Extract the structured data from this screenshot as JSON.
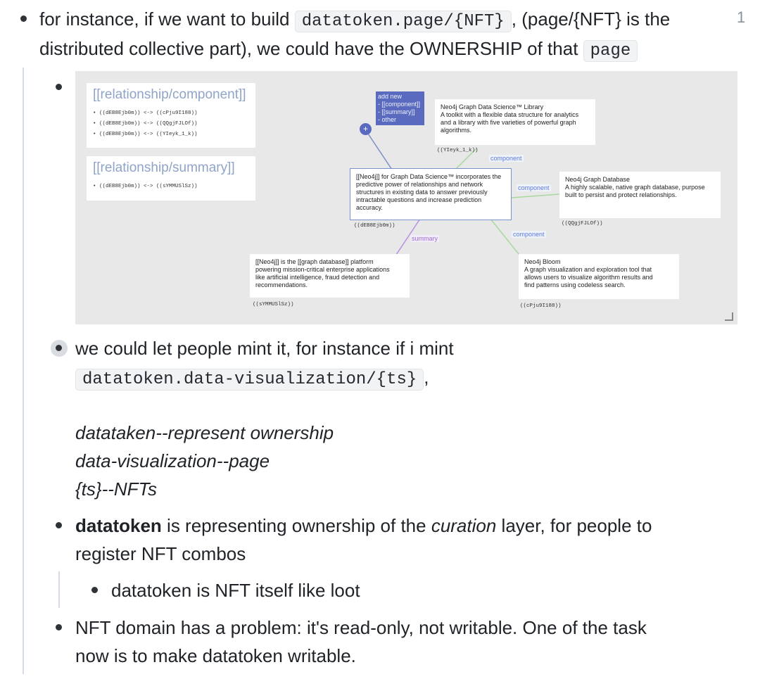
{
  "counter": "1",
  "top_block": {
    "line1_a": "for instance, if we want to build ",
    "line1_code": "datatoken.page/{NFT}",
    "line1_b": ", (page/{NFT} is the",
    "line2_a": "distributed collective part), we could have the OWNERSHIP of that ",
    "line2_code": "page"
  },
  "diagram": {
    "rel_component": {
      "title": "[[relationship/component]]",
      "rows": [
        "((dEB8Ejb0m)) <-> ((cPju9I188))",
        "((dEB8Ejb0m)) <-> ((QQgjFJLOf))",
        "((dEB8Ejb0m)) <-> ((YIeyk_1_k))"
      ]
    },
    "rel_summary": {
      "title": "[[relationship/summary]]",
      "rows": [
        "((dEB8Ejb0m)) <-> ((sYMMUSlSz))"
      ]
    },
    "menu": [
      "add new",
      "- [[component]]",
      "- [[summary]]",
      "- other"
    ],
    "plus": "+",
    "nodes": {
      "library": {
        "lines": [
          "Neo4j Graph Data Science™ Library",
          "A toolkit with a flexible data structure for analytics",
          "and a library with five varieties of powerful graph",
          "algorithms."
        ],
        "ref": "((YIeyk_1_k))"
      },
      "center": {
        "lines": [
          "[[Neo4j]] for Graph Data Science™ incorporates the",
          "predictive power of relationships and network",
          "structures in existing data to answer previously",
          "intractable questions and increase prediction",
          "accuracy."
        ],
        "ref": "((dEB8Ejb0m))"
      },
      "database": {
        "lines": [
          "Neo4j Graph Database",
          "A highly scalable, native graph database, purpose",
          "built to persist and protect relationships."
        ],
        "ref": "((QQgjFJLOf))"
      },
      "platform": {
        "lines": [
          "[[Neo4j]] is the [[graph database]] platform",
          "powering mission-critical enterprise applications",
          "like artificial intelligence, fraud detection and",
          "recommendations."
        ],
        "ref": "((sYMMUSlSz))"
      },
      "bloom": {
        "lines": [
          "Neo4j Bloom",
          "A graph visualization and exploration tool that",
          "allows users to visualize algorithm results and",
          "find patterns using codeless search."
        ],
        "ref": "((cPju9I188))"
      }
    },
    "edge_labels": {
      "e1": "component",
      "e2": "component",
      "e3": "component",
      "e4": "summary"
    }
  },
  "mint": {
    "line1": "we could let people mint it, for instance if i mint",
    "code": "datatoken.data-visualization/{ts}",
    "comma": ",",
    "it1": "datataken--represent ownership",
    "it2": "data-visualization--page",
    "it3": "{ts}--NFTs"
  },
  "datatoken": {
    "bold": "datatoken",
    "a": " is representing ownership of the ",
    "it": "curation",
    "b": " layer, for people to",
    "line2": "register NFT combos",
    "child": "datatoken is NFT itself like loot"
  },
  "nftdomain": {
    "line1": "NFT domain has a problem: it's read-only, not writable. One of the task",
    "line2": "now is to make datatoken writable."
  }
}
